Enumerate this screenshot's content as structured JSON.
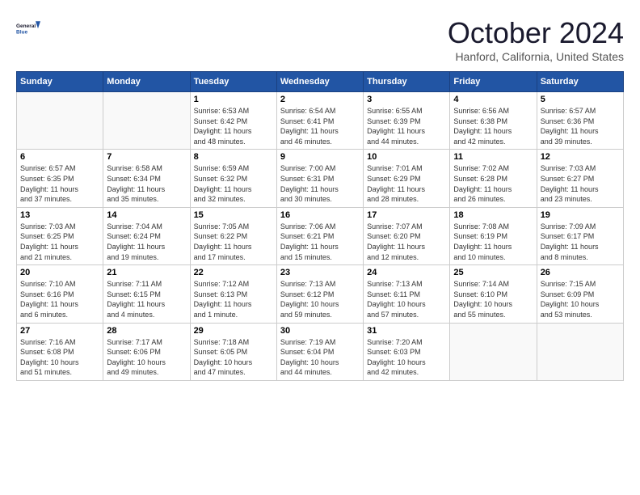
{
  "header": {
    "logo_line1": "General",
    "logo_line2": "Blue",
    "month_title": "October 2024",
    "location": "Hanford, California, United States"
  },
  "weekdays": [
    "Sunday",
    "Monday",
    "Tuesday",
    "Wednesday",
    "Thursday",
    "Friday",
    "Saturday"
  ],
  "weeks": [
    [
      {
        "day": "",
        "info": ""
      },
      {
        "day": "",
        "info": ""
      },
      {
        "day": "1",
        "info": "Sunrise: 6:53 AM\nSunset: 6:42 PM\nDaylight: 11 hours\nand 48 minutes."
      },
      {
        "day": "2",
        "info": "Sunrise: 6:54 AM\nSunset: 6:41 PM\nDaylight: 11 hours\nand 46 minutes."
      },
      {
        "day": "3",
        "info": "Sunrise: 6:55 AM\nSunset: 6:39 PM\nDaylight: 11 hours\nand 44 minutes."
      },
      {
        "day": "4",
        "info": "Sunrise: 6:56 AM\nSunset: 6:38 PM\nDaylight: 11 hours\nand 42 minutes."
      },
      {
        "day": "5",
        "info": "Sunrise: 6:57 AM\nSunset: 6:36 PM\nDaylight: 11 hours\nand 39 minutes."
      }
    ],
    [
      {
        "day": "6",
        "info": "Sunrise: 6:57 AM\nSunset: 6:35 PM\nDaylight: 11 hours\nand 37 minutes."
      },
      {
        "day": "7",
        "info": "Sunrise: 6:58 AM\nSunset: 6:34 PM\nDaylight: 11 hours\nand 35 minutes."
      },
      {
        "day": "8",
        "info": "Sunrise: 6:59 AM\nSunset: 6:32 PM\nDaylight: 11 hours\nand 32 minutes."
      },
      {
        "day": "9",
        "info": "Sunrise: 7:00 AM\nSunset: 6:31 PM\nDaylight: 11 hours\nand 30 minutes."
      },
      {
        "day": "10",
        "info": "Sunrise: 7:01 AM\nSunset: 6:29 PM\nDaylight: 11 hours\nand 28 minutes."
      },
      {
        "day": "11",
        "info": "Sunrise: 7:02 AM\nSunset: 6:28 PM\nDaylight: 11 hours\nand 26 minutes."
      },
      {
        "day": "12",
        "info": "Sunrise: 7:03 AM\nSunset: 6:27 PM\nDaylight: 11 hours\nand 23 minutes."
      }
    ],
    [
      {
        "day": "13",
        "info": "Sunrise: 7:03 AM\nSunset: 6:25 PM\nDaylight: 11 hours\nand 21 minutes."
      },
      {
        "day": "14",
        "info": "Sunrise: 7:04 AM\nSunset: 6:24 PM\nDaylight: 11 hours\nand 19 minutes."
      },
      {
        "day": "15",
        "info": "Sunrise: 7:05 AM\nSunset: 6:22 PM\nDaylight: 11 hours\nand 17 minutes."
      },
      {
        "day": "16",
        "info": "Sunrise: 7:06 AM\nSunset: 6:21 PM\nDaylight: 11 hours\nand 15 minutes."
      },
      {
        "day": "17",
        "info": "Sunrise: 7:07 AM\nSunset: 6:20 PM\nDaylight: 11 hours\nand 12 minutes."
      },
      {
        "day": "18",
        "info": "Sunrise: 7:08 AM\nSunset: 6:19 PM\nDaylight: 11 hours\nand 10 minutes."
      },
      {
        "day": "19",
        "info": "Sunrise: 7:09 AM\nSunset: 6:17 PM\nDaylight: 11 hours\nand 8 minutes."
      }
    ],
    [
      {
        "day": "20",
        "info": "Sunrise: 7:10 AM\nSunset: 6:16 PM\nDaylight: 11 hours\nand 6 minutes."
      },
      {
        "day": "21",
        "info": "Sunrise: 7:11 AM\nSunset: 6:15 PM\nDaylight: 11 hours\nand 4 minutes."
      },
      {
        "day": "22",
        "info": "Sunrise: 7:12 AM\nSunset: 6:13 PM\nDaylight: 11 hours\nand 1 minute."
      },
      {
        "day": "23",
        "info": "Sunrise: 7:13 AM\nSunset: 6:12 PM\nDaylight: 10 hours\nand 59 minutes."
      },
      {
        "day": "24",
        "info": "Sunrise: 7:13 AM\nSunset: 6:11 PM\nDaylight: 10 hours\nand 57 minutes."
      },
      {
        "day": "25",
        "info": "Sunrise: 7:14 AM\nSunset: 6:10 PM\nDaylight: 10 hours\nand 55 minutes."
      },
      {
        "day": "26",
        "info": "Sunrise: 7:15 AM\nSunset: 6:09 PM\nDaylight: 10 hours\nand 53 minutes."
      }
    ],
    [
      {
        "day": "27",
        "info": "Sunrise: 7:16 AM\nSunset: 6:08 PM\nDaylight: 10 hours\nand 51 minutes."
      },
      {
        "day": "28",
        "info": "Sunrise: 7:17 AM\nSunset: 6:06 PM\nDaylight: 10 hours\nand 49 minutes."
      },
      {
        "day": "29",
        "info": "Sunrise: 7:18 AM\nSunset: 6:05 PM\nDaylight: 10 hours\nand 47 minutes."
      },
      {
        "day": "30",
        "info": "Sunrise: 7:19 AM\nSunset: 6:04 PM\nDaylight: 10 hours\nand 44 minutes."
      },
      {
        "day": "31",
        "info": "Sunrise: 7:20 AM\nSunset: 6:03 PM\nDaylight: 10 hours\nand 42 minutes."
      },
      {
        "day": "",
        "info": ""
      },
      {
        "day": "",
        "info": ""
      }
    ]
  ]
}
